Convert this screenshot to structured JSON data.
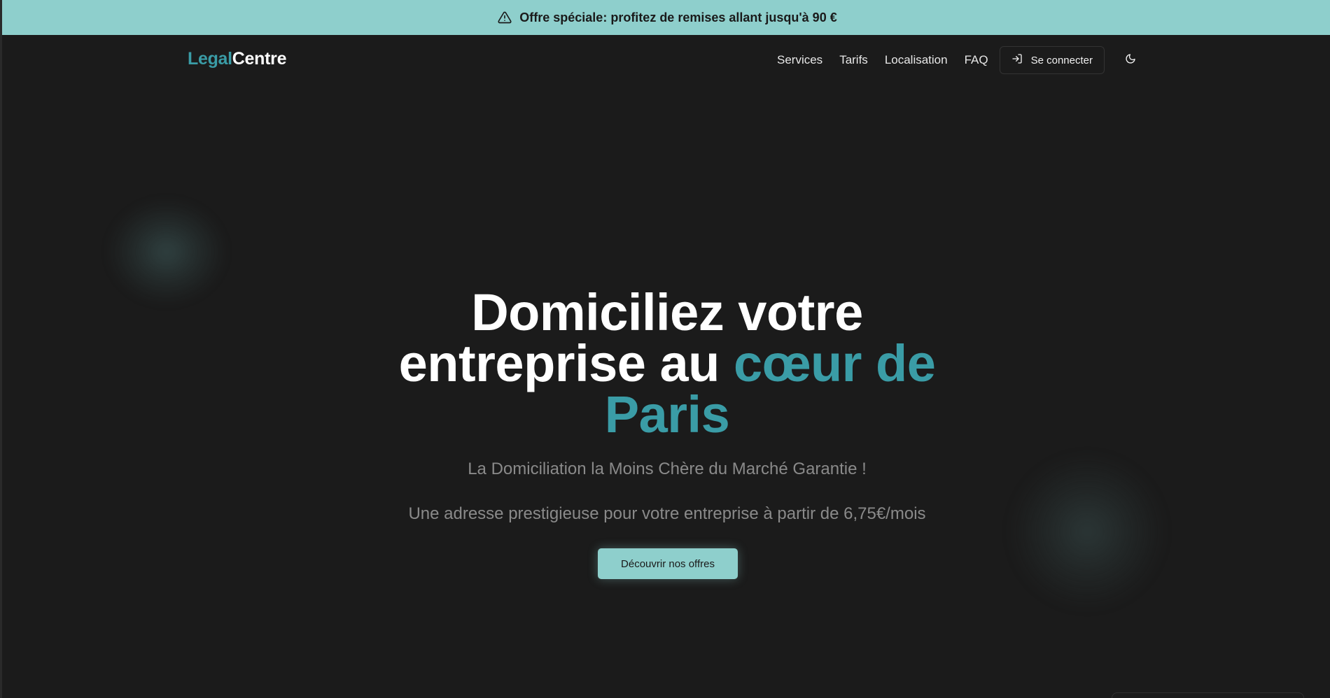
{
  "promo": {
    "icon": "warning-triangle-icon",
    "text": "Offre spéciale: profitez de remises allant jusqu'à 90 €"
  },
  "brand": {
    "part1": "Legal",
    "part2": "Centre"
  },
  "nav": {
    "links": [
      "Services",
      "Tarifs",
      "Localisation",
      "FAQ"
    ],
    "login_label": "Se connecter",
    "login_icon": "log-in-icon",
    "theme_icon": "moon-icon"
  },
  "hero": {
    "title_line_1": "Domiciliez votre",
    "title_line_2_plain": "entreprise au ",
    "title_line_2_accent": "cœur de",
    "title_line_3_accent": "Paris",
    "subtitle_1": "La Domiciliation la Moins Chère du Marché Garantie !",
    "subtitle_2": "Une adresse prestigieuse pour votre entreprise à partir de 6,75€/mois",
    "cta_label": "Découvrir nos offres"
  },
  "colors": {
    "accent": "#3a9ca6",
    "promo_bg": "#8ecfcc",
    "page_bg": "#1b1b1b"
  }
}
